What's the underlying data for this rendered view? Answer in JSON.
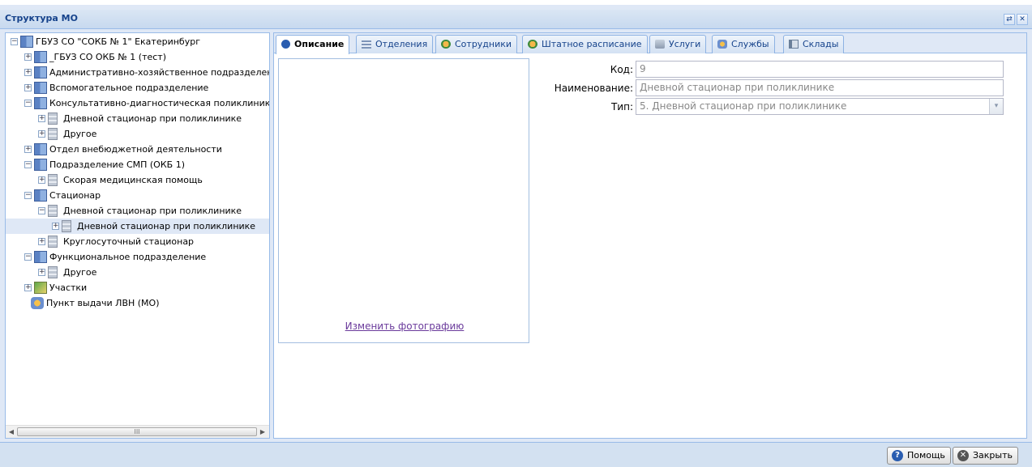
{
  "window": {
    "title": "Структура МО",
    "tools": [
      "refresh-icon",
      "close-icon"
    ]
  },
  "tree": {
    "nodes": [
      {
        "label": "ГБУЗ СО \"СОКБ № 1\" Екатеринбург",
        "icon": "building-icon",
        "expander": "−"
      },
      {
        "label": "_ГБУЗ СО ОКБ № 1 (тест)",
        "icon": "building-icon",
        "expander": "+"
      },
      {
        "label": "Административно-хозяйственное подразделение",
        "icon": "building-icon",
        "expander": "+"
      },
      {
        "label": "Вспомогательное подразделение",
        "icon": "building-icon",
        "expander": "+"
      },
      {
        "label": "Консультативно-диагностическая поликлиника",
        "icon": "building-icon",
        "expander": "−"
      },
      {
        "label": "Дневной стационар при поликлинике",
        "icon": "department-icon",
        "expander": "+"
      },
      {
        "label": "Другое",
        "icon": "department-icon",
        "expander": "+"
      },
      {
        "label": "Отдел внебюджетной деятельности",
        "icon": "building-icon",
        "expander": "+"
      },
      {
        "label": "Подразделение СМП (ОКБ 1)",
        "icon": "building-icon",
        "expander": "−"
      },
      {
        "label": "Скорая медицинская помощь",
        "icon": "department-icon",
        "expander": "+"
      },
      {
        "label": "Стационар",
        "icon": "building-icon",
        "expander": "−"
      },
      {
        "label": "Дневной стационар при поликлинике",
        "icon": "department-icon",
        "expander": "−"
      },
      {
        "label": "Дневной стационар при поликлинике",
        "icon": "department-icon",
        "expander": "+",
        "selected": true
      },
      {
        "label": "Круглосуточный стационар",
        "icon": "department-icon",
        "expander": "+"
      },
      {
        "label": "Функциональное подразделение",
        "icon": "building-icon",
        "expander": "−"
      },
      {
        "label": "Другое",
        "icon": "department-icon",
        "expander": "+"
      },
      {
        "label": "Участки",
        "icon": "map-icon",
        "expander": "+"
      },
      {
        "label": "Пункт выдачи ЛВН (МО)",
        "icon": "service-point-icon",
        "expander": ""
      }
    ],
    "scroll_thumb_label": "III"
  },
  "tabs": [
    {
      "label": "Описание",
      "icon": "info-icon",
      "active": true
    },
    {
      "label": "Отделения",
      "icon": "list-icon"
    },
    {
      "label": "Сотрудники",
      "icon": "staff-icon"
    },
    {
      "label": "Штатное расписание",
      "icon": "staff-icon"
    },
    {
      "label": "Услуги",
      "icon": "services-icon"
    },
    {
      "label": "Службы",
      "icon": "service-point-icon"
    },
    {
      "label": "Склады",
      "icon": "warehouse-icon"
    }
  ],
  "description": {
    "photo_link": "Изменить фотографию",
    "code_label": "Код:",
    "code_value": "9",
    "name_label": "Наименование:",
    "name_value": "Дневной стационар при поликлинике",
    "type_label": "Тип:",
    "type_value": "5. Дневной стационар при поликлинике"
  },
  "footer": {
    "help_label": "Помощь",
    "close_label": "Закрыть"
  },
  "colors": {
    "title": "#15428b",
    "panel_border": "#99bbe8",
    "background": "#dfe8f6",
    "link": "#6a3a9b"
  }
}
